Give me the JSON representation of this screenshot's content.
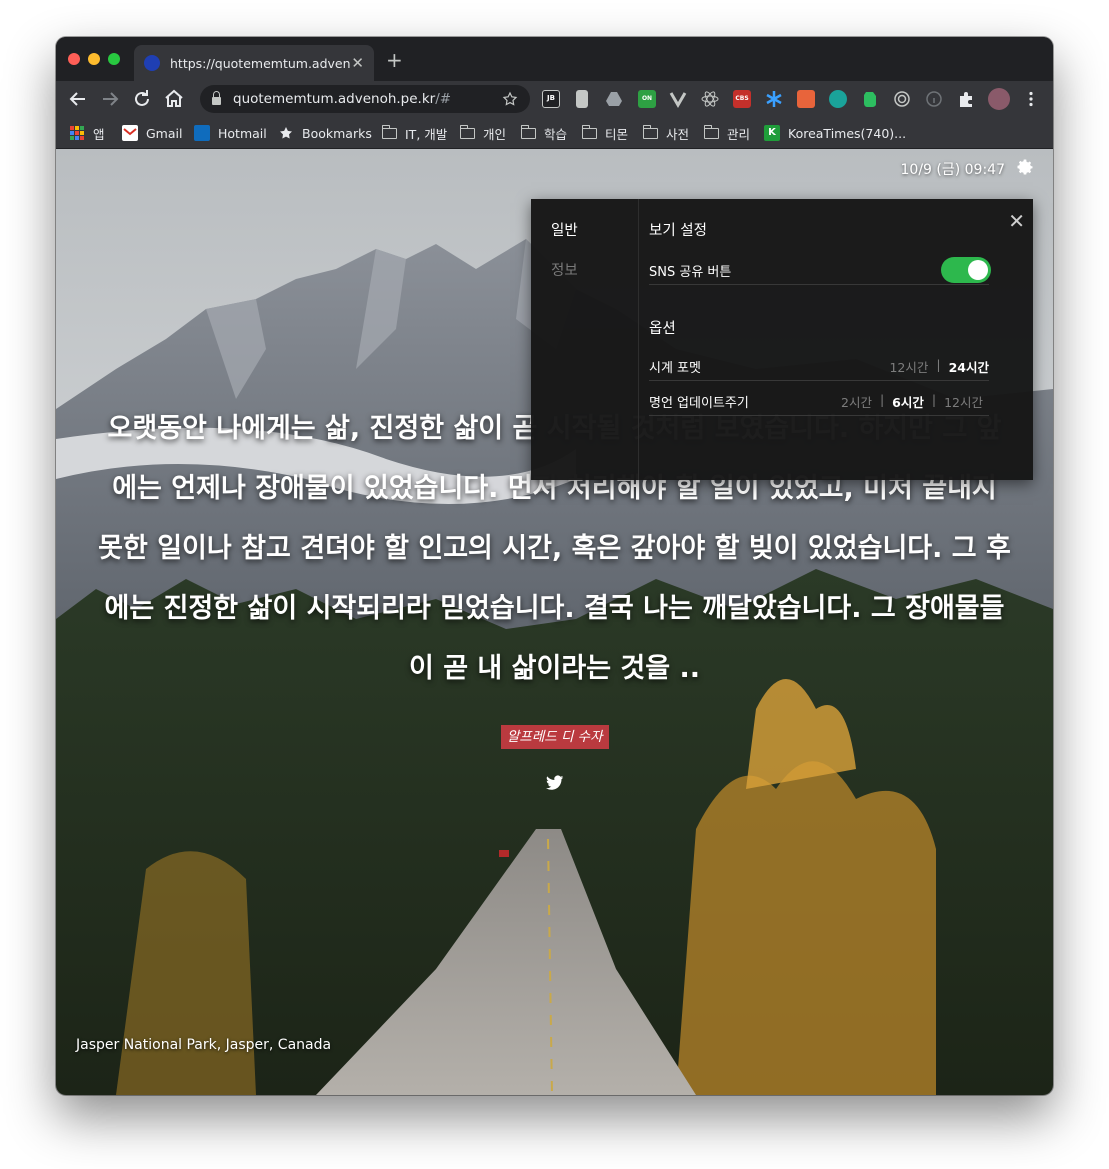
{
  "browser": {
    "tab_title": "https://quotememtum.advenoh",
    "tab_close": "✕",
    "new_tab": "+",
    "url_host": "quotememtum.advenoh.pe.kr",
    "url_path": "/#",
    "extension_labels": {
      "jb": "JB",
      "on": "ON",
      "cbs": "CBS"
    }
  },
  "bookmarks": [
    {
      "label": "앱",
      "icon": "apps-grid-icon"
    },
    {
      "label": "Gmail",
      "icon": "gmail-icon"
    },
    {
      "label": "Hotmail",
      "icon": "outlook-icon"
    },
    {
      "label": "Bookmarks",
      "icon": "star-icon"
    },
    {
      "label": "IT, 개발",
      "icon": "folder-icon"
    },
    {
      "label": "개인",
      "icon": "folder-icon"
    },
    {
      "label": "학습",
      "icon": "folder-icon"
    },
    {
      "label": "티몬",
      "icon": "folder-icon"
    },
    {
      "label": "사전",
      "icon": "folder-icon"
    },
    {
      "label": "관리",
      "icon": "folder-icon"
    },
    {
      "label": "KoreaTimes(740)...",
      "icon": "koreatimes-icon",
      "icon_text": "K"
    }
  ],
  "page": {
    "clock": "10/9 (금) 09:47",
    "quote": "오랫동안 나에게는 삶, 진정한 삶이 곧 시작될 것처럼 보였습니다. 하지만 그 앞에는 언제나 장애물이 있었습니다. 먼저 처리해야 할 일이 있었고, 미처 끝내지 못한 일이나 참고 견뎌야 할 인고의 시간, 혹은 갚아야 할 빚이 있었습니다. 그 후에는 진정한 삶이 시작되리라 믿었습니다. 결국 나는 깨달았습니다. 그 장애물들이 곧 내 삶이라는 것을 ..",
    "author": "알프레드 디 수자",
    "location": "Jasper National Park, Jasper, Canada"
  },
  "settings": {
    "tabs": {
      "general": "일반",
      "info": "정보"
    },
    "close": "✕",
    "view_title": "보기 설정",
    "sns_label": "SNS 공유 버튼",
    "sns_enabled": true,
    "options_title": "옵션",
    "clock_format": {
      "label": "시계 포멧",
      "options": [
        "12시간",
        "24시간"
      ],
      "selected": "24시간"
    },
    "quote_update": {
      "label": "명언 업데이트주기",
      "options": [
        "2시간",
        "6시간",
        "12시간"
      ],
      "selected": "6시간"
    }
  },
  "colors": {
    "toggle_on": "#2db84d",
    "author_badge": "#dc3c46",
    "tab_favicon": "#1f3fb3"
  }
}
